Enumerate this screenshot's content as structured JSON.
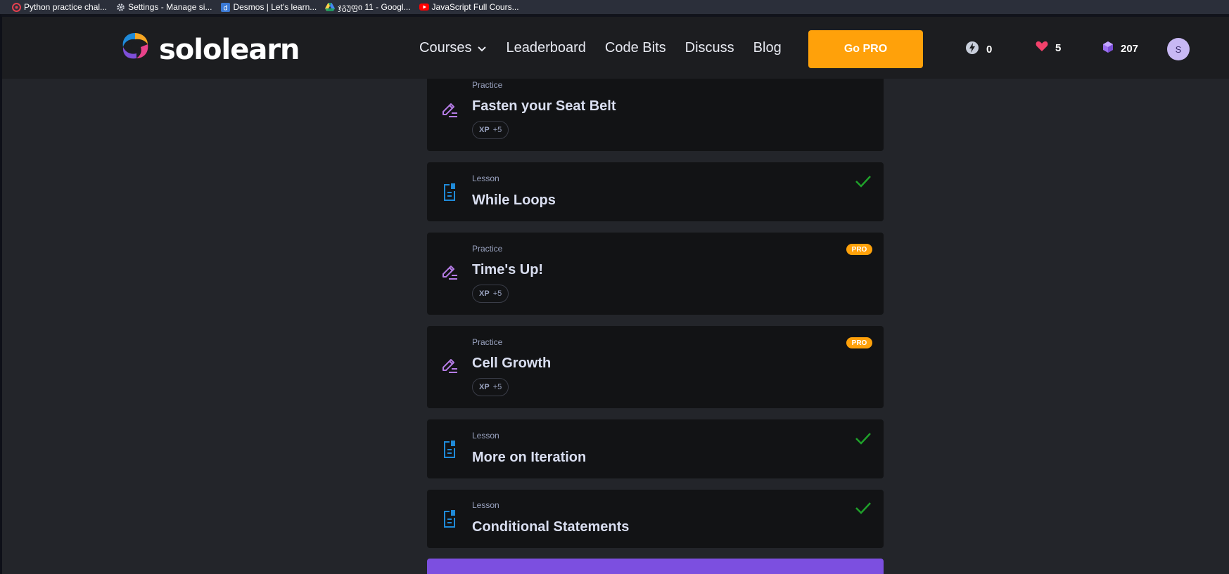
{
  "bookmarks": [
    {
      "label": "Python practice chal...",
      "icon": "python-challenge-icon"
    },
    {
      "label": "Settings - Manage si...",
      "icon": "gear-icon"
    },
    {
      "label": "Desmos | Let's learn...",
      "icon": "desmos-icon"
    },
    {
      "label": "ჯგუფი 11 - Googl...",
      "icon": "google-drive-icon"
    },
    {
      "label": "JavaScript Full Cours...",
      "icon": "youtube-icon"
    }
  ],
  "header": {
    "logo_text": "sololearn",
    "nav": {
      "courses": "Courses",
      "leaderboard": "Leaderboard",
      "code_bits": "Code Bits",
      "discuss": "Discuss",
      "blog": "Blog"
    },
    "go_pro": "Go PRO",
    "streak": "0",
    "hearts": "5",
    "bits": "207",
    "avatar_initial": "S"
  },
  "cards": [
    {
      "type": "Practice",
      "title": "Fasten your Seat Belt",
      "xp_label": "XP",
      "xp_value": "+5"
    },
    {
      "type": "Lesson",
      "title": "While Loops",
      "completed": true
    },
    {
      "type": "Practice",
      "title": "Time's Up!",
      "xp_label": "XP",
      "xp_value": "+5",
      "pro_label": "PRO"
    },
    {
      "type": "Practice",
      "title": "Cell Growth",
      "xp_label": "XP",
      "xp_value": "+5",
      "pro_label": "PRO"
    },
    {
      "type": "Lesson",
      "title": "More on Iteration",
      "completed": true
    },
    {
      "type": "Lesson",
      "title": "Conditional Statements",
      "completed": true
    }
  ],
  "colors": {
    "accent_orange": "#ffa10a",
    "practice_icon": "#b57ce6",
    "lesson_icon": "#1f8ad8",
    "check_green": "#1fa12a",
    "start_bar": "#7c4fe0"
  }
}
